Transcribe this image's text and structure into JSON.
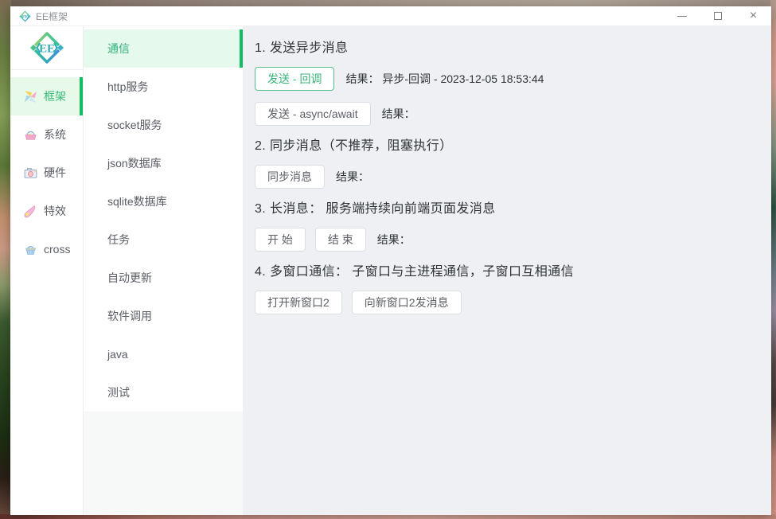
{
  "window": {
    "title": "EE框架",
    "controls": {
      "close_glyph": "×"
    }
  },
  "colors": {
    "accent_green": "#2eb378",
    "selected_bg": "#e5f9ec",
    "selected_bar": "#12bd61",
    "main_bg": "#eef0f4"
  },
  "sidebar": {
    "logo_text": "EE",
    "items": [
      {
        "label": "框架",
        "icon": "pinwheel-icon",
        "selected": true
      },
      {
        "label": "系统",
        "icon": "egg-basket-icon",
        "selected": false
      },
      {
        "label": "硬件",
        "icon": "camera-icon",
        "selected": false
      },
      {
        "label": "特效",
        "icon": "comet-icon",
        "selected": false
      },
      {
        "label": "cross",
        "icon": "basket-icon",
        "selected": false
      }
    ]
  },
  "menu": {
    "selected": "通信",
    "items": [
      "通信",
      "http服务",
      "socket服务",
      "json数据库",
      "sqlite数据库",
      "任务",
      "自动更新",
      "软件调用",
      "java",
      "测试"
    ]
  },
  "main": {
    "sections": [
      {
        "heading": "1. 发送异步消息",
        "rows": [
          {
            "buttons": [
              {
                "label": "发送 - 回调",
                "style": "success"
              }
            ],
            "result_label": "结果：",
            "result_value": "异步-回调 - 2023-12-05 18:53:44"
          },
          {
            "buttons": [
              {
                "label": "发送 - async/await",
                "style": "default"
              }
            ],
            "result_label": "结果：",
            "result_value": ""
          }
        ]
      },
      {
        "heading": "2. 同步消息（不推荐，阻塞执行）",
        "rows": [
          {
            "buttons": [
              {
                "label": "同步消息",
                "style": "default"
              }
            ],
            "result_label": "结果：",
            "result_value": ""
          }
        ]
      },
      {
        "heading": "3. 长消息： 服务端持续向前端页面发消息",
        "rows": [
          {
            "buttons": [
              {
                "label": "开 始",
                "style": "default"
              },
              {
                "label": "结 束",
                "style": "default"
              }
            ],
            "result_label": "结果：",
            "result_value": ""
          }
        ]
      },
      {
        "heading": "4. 多窗口通信： 子窗口与主进程通信，子窗口互相通信",
        "rows": [
          {
            "buttons": [
              {
                "label": "打开新窗口2",
                "style": "default"
              },
              {
                "label": "向新窗口2发消息",
                "style": "default"
              }
            ]
          }
        ]
      }
    ]
  }
}
